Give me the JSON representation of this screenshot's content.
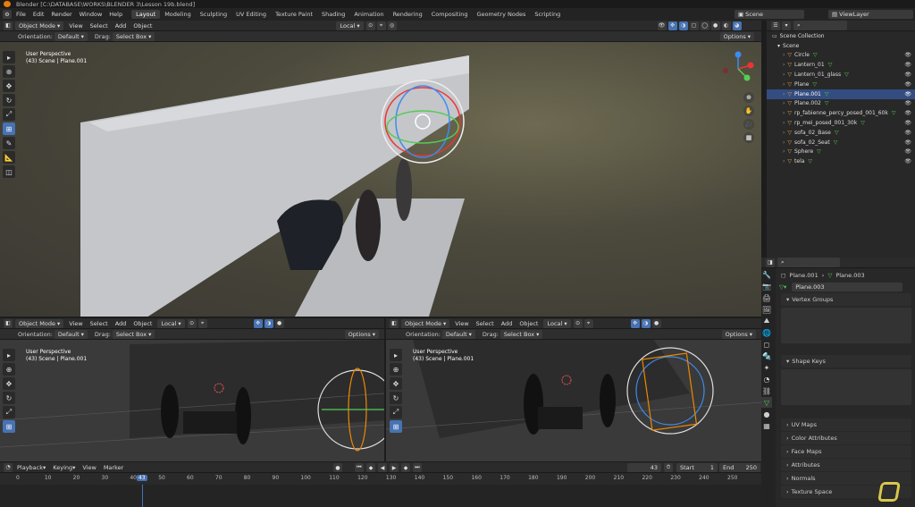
{
  "window": {
    "title": "Blender [C:\\DATABASE\\WORKS\\BLENDER 3\\Lesson 19b.blend]"
  },
  "menus": [
    "File",
    "Edit",
    "Render",
    "Window",
    "Help"
  ],
  "workspaces": [
    "Layout",
    "Modeling",
    "Sculpting",
    "UV Editing",
    "Texture Paint",
    "Shading",
    "Animation",
    "Rendering",
    "Compositing",
    "Geometry Nodes",
    "Scripting"
  ],
  "scene": {
    "name": "Scene",
    "view_layer": "ViewLayer"
  },
  "viewport_header": {
    "mode": "Object Mode",
    "menu": [
      "View",
      "Select",
      "Add",
      "Object"
    ],
    "transform": "Local",
    "options": "Options",
    "orientation_label": "Orientation:",
    "orientation": "Default",
    "drag_label": "Drag:",
    "drag": "Select Box"
  },
  "viewport_info": {
    "line1": "User Perspective",
    "line2": "(43) Scene | Plane.001"
  },
  "outliner": {
    "collection": "Scene Collection",
    "root": "Scene",
    "items": [
      "Circle",
      "Lantern_01",
      "Lantern_01_glass",
      "Plane",
      "Plane.001",
      "Plane.002",
      "rp_fabienne_percy_posed_001_60k",
      "rp_mei_posed_001_30k",
      "sofa_02_Base",
      "sofa_02_Seat",
      "Sphere",
      "tela"
    ],
    "selected_index": 4
  },
  "properties": {
    "breadcrumb_object": "Plane.001",
    "breadcrumb_mesh": "Plane.003",
    "mesh_name": "Plane.003",
    "sections": [
      "Vertex Groups",
      "Shape Keys",
      "UV Maps",
      "Color Attributes",
      "Face Maps",
      "Attributes",
      "Normals",
      "Texture Space"
    ]
  },
  "timeline": {
    "menu": [
      "Playback",
      "Keying",
      "View",
      "Marker"
    ],
    "current_frame": "43",
    "start_label": "Start",
    "start": "1",
    "end_label": "End",
    "end": "250",
    "ticks": [
      "0",
      "10",
      "20",
      "30",
      "40",
      "43",
      "50",
      "60",
      "70",
      "80",
      "90",
      "100",
      "110",
      "120",
      "130",
      "140",
      "150",
      "160",
      "170",
      "180",
      "190",
      "200",
      "210",
      "220",
      "230",
      "240",
      "250"
    ]
  }
}
